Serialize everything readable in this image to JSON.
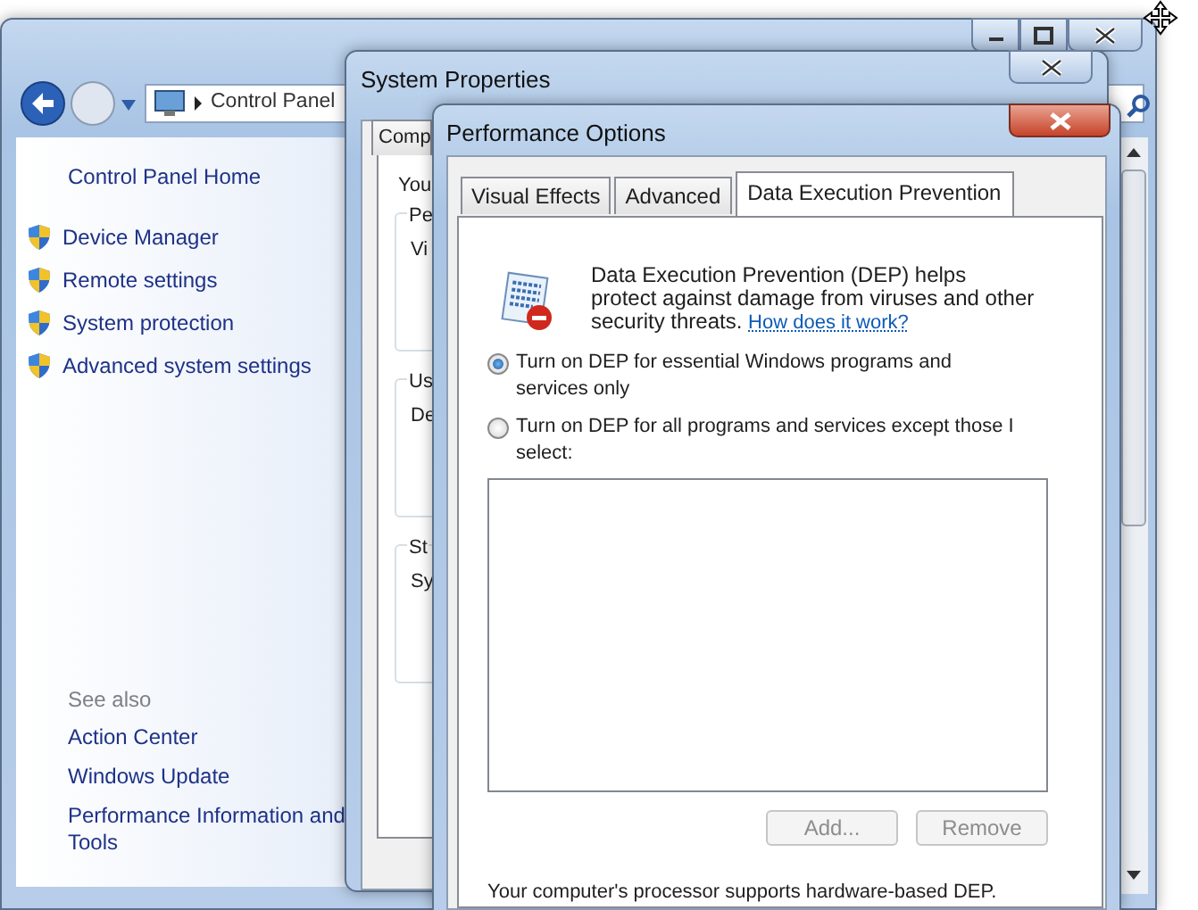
{
  "control_panel": {
    "address": "Control Panel",
    "left_pane": {
      "home": "Control Panel Home",
      "tasks": [
        {
          "label": "Device Manager"
        },
        {
          "label": "Remote settings"
        },
        {
          "label": "System protection"
        },
        {
          "label": "Advanced system settings"
        }
      ],
      "see_also_heading": "See also",
      "see_also": [
        "Action Center",
        "Windows Update",
        "Performance Information and Tools"
      ]
    }
  },
  "system_properties": {
    "title": "System Properties",
    "tab": "Comp",
    "intro": "You",
    "groups": [
      {
        "label": "Pe",
        "line": "Vi"
      },
      {
        "label": "Us",
        "line": "De"
      },
      {
        "label": "St",
        "line": "Sy"
      }
    ]
  },
  "performance_options": {
    "title": "Performance Options",
    "tabs": [
      {
        "label": "Visual Effects",
        "selected": false
      },
      {
        "label": "Advanced",
        "selected": false
      },
      {
        "label": "Data Execution Prevention",
        "selected": true
      }
    ],
    "description": "Data Execution Prevention (DEP) helps protect against damage from viruses and other security threats.",
    "link": "How does it work?",
    "options": [
      {
        "label": "Turn on DEP for essential Windows programs and services only",
        "selected": true
      },
      {
        "label": "Turn on DEP for all programs and services except those I select:",
        "selected": false
      }
    ],
    "buttons": [
      {
        "label": "Add...",
        "disabled": true
      },
      {
        "label": "Remove",
        "disabled": true
      }
    ],
    "footer": "Your computer's processor supports hardware-based DEP."
  }
}
